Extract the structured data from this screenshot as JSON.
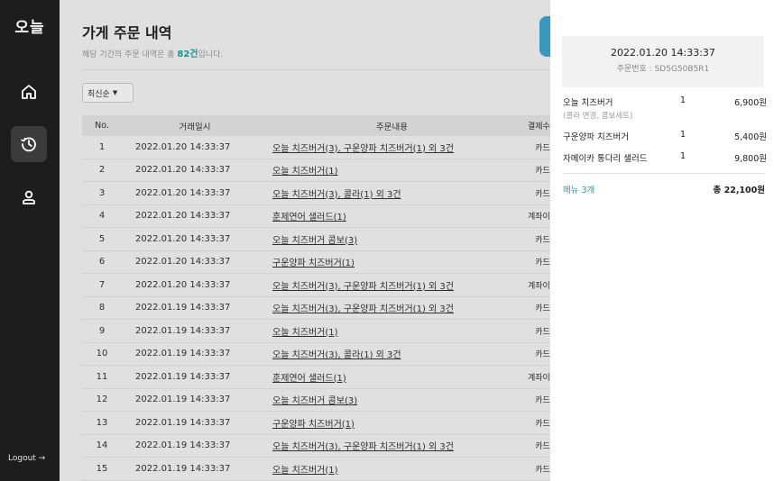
{
  "sidebar": {
    "logo": "오늘",
    "nav": [
      {
        "name": "home",
        "icon": "home-icon"
      },
      {
        "name": "history",
        "icon": "history-icon",
        "active": true
      },
      {
        "name": "user",
        "icon": "user-icon"
      }
    ],
    "logout_label": "Logout →"
  },
  "header": {
    "title": "가게 주문 내역",
    "subtitle_prefix": "해당 기간의 주문 내역은 총 ",
    "subtitle_count": "82건",
    "subtitle_suffix": "입니다."
  },
  "sort": {
    "selected": "최신순",
    "caret": "▼"
  },
  "table": {
    "columns": {
      "no": "No.",
      "date": "거래일시",
      "menu": "주문내용",
      "payment": "결제수단"
    },
    "rows": [
      {
        "no": "1",
        "date": "2022.01.20  14:33:37",
        "menu": "오늘 치즈버거(3), 구운양파 치즈버거(1) 외 3건",
        "payment": "카드"
      },
      {
        "no": "2",
        "date": "2022.01.20  14:33:37",
        "menu": "오늘 치즈버거(1)",
        "payment": "카드"
      },
      {
        "no": "3",
        "date": "2022.01.20  14:33:37",
        "menu": "오늘 치즈버거(3), 콜라(1) 외 3건",
        "payment": "카드"
      },
      {
        "no": "4",
        "date": "2022.01.20  14:33:37",
        "menu": "훈제연어 샐러드(1)",
        "payment": "계좌이체"
      },
      {
        "no": "5",
        "date": "2022.01.20  14:33:37",
        "menu": "오늘 치즈버거 콤보(3)",
        "payment": "카드"
      },
      {
        "no": "6",
        "date": "2022.01.20  14:33:37",
        "menu": "구운양파 치즈버거(1)",
        "payment": "카드"
      },
      {
        "no": "7",
        "date": "2022.01.20  14:33:37",
        "menu": "오늘 치즈버거(3), 구운양파 치즈버거(1) 외 3건",
        "payment": "계좌이체"
      },
      {
        "no": "8",
        "date": "2022.01.19  14:33:37",
        "menu": "오늘 치즈버거(3), 구운양파 치즈버거(1) 외 3건",
        "payment": "카드"
      },
      {
        "no": "9",
        "date": "2022.01.19  14:33:37",
        "menu": "오늘 치즈버거(1)",
        "payment": "카드"
      },
      {
        "no": "10",
        "date": "2022.01.19  14:33:37",
        "menu": "오늘 치즈버거(3), 콜라(1) 외 3건",
        "payment": "카드"
      },
      {
        "no": "11",
        "date": "2022.01.19  14:33:37",
        "menu": "훈제연어 샐러드(1)",
        "payment": "계좌이체"
      },
      {
        "no": "12",
        "date": "2022.01.19  14:33:37",
        "menu": "오늘 치즈버거 콤보(3)",
        "payment": "카드"
      },
      {
        "no": "13",
        "date": "2022.01.19  14:33:37",
        "menu": "구운양파 치즈버거(1)",
        "payment": "카드"
      },
      {
        "no": "14",
        "date": "2022.01.19  14:33:37",
        "menu": "오늘 치즈버거(3), 구운양파 치즈버거(1) 외 3건",
        "payment": "카드"
      },
      {
        "no": "15",
        "date": "2022.01.19  14:33:37",
        "menu": "오늘 치즈버거(1)",
        "payment": "카드"
      }
    ]
  },
  "receipt": {
    "date": "2022.01.20  14:33:37",
    "order_no": "주문번호 : SD5G50B5R1",
    "items": [
      {
        "name": "오늘 치즈버거",
        "qty": "1",
        "price": "6,900원",
        "option": "(콜라 변경, 콤보세트)"
      },
      {
        "name": "구운양파 치즈버거",
        "qty": "1",
        "price": "5,400원",
        "option": ""
      },
      {
        "name": "자메이카 통다리 샐러드",
        "qty": "1",
        "price": "9,800원",
        "option": ""
      }
    ],
    "menu_count": "메뉴 3개",
    "total": "총 22,100원"
  },
  "colors": {
    "accent": "#1aa39b",
    "sidebar": "#1d1d1d",
    "button": "#3fa8d5"
  }
}
